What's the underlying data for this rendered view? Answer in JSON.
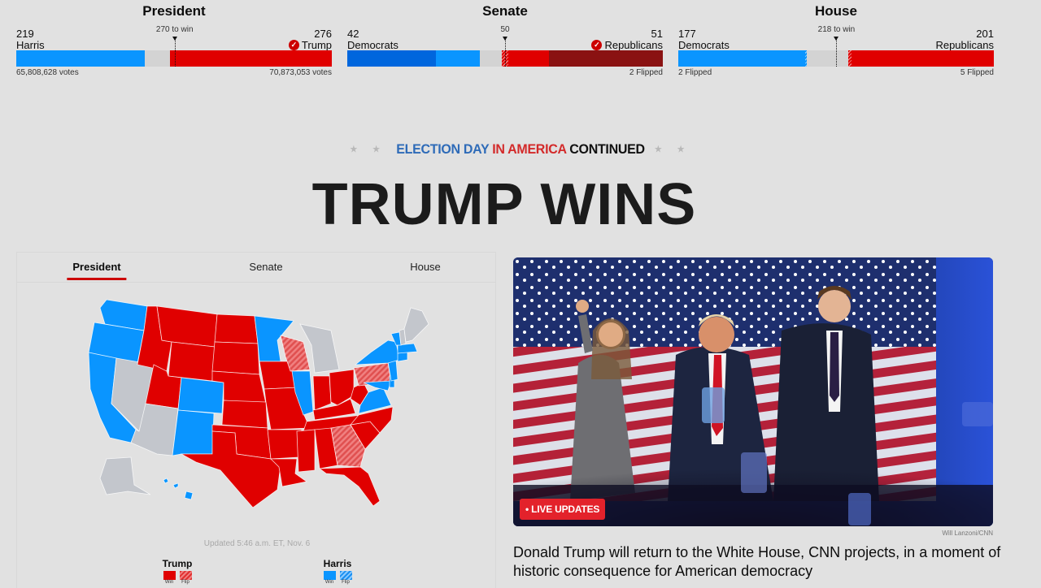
{
  "colors": {
    "dem_safe": "#0a95ff",
    "dem_hold": "#0066dd",
    "rep_win": "#e00000",
    "rep_hold": "#8a1212",
    "undecided": "#d3d3d3",
    "map_gray": "#c3c6cc",
    "accent_red": "#cc0000"
  },
  "races": [
    {
      "title": "President",
      "left": {
        "count": "219",
        "name": "Harris",
        "foot": "65,808,628 votes"
      },
      "right": {
        "count": "276",
        "name": "Trump",
        "foot": "70,873,053 votes",
        "winner": true
      },
      "threshold_label": "270 to win",
      "total": 538,
      "threshold": 270,
      "segments_left": [
        {
          "value": 219,
          "style": "dem"
        }
      ],
      "segments_right": [
        {
          "value": 276,
          "style": "rep"
        }
      ]
    },
    {
      "title": "Senate",
      "left": {
        "count": "42",
        "name": "Democrats",
        "foot": ""
      },
      "right": {
        "count": "51",
        "name": "Republicans",
        "foot": "2 Flipped",
        "winner": true
      },
      "threshold_label": "50",
      "total": 100,
      "threshold": 50,
      "segments_left": [
        {
          "value": 28,
          "style": "dem_hold"
        },
        {
          "value": 14,
          "style": "dem"
        }
      ],
      "segments_right": [
        {
          "value": 2,
          "style": "rep_flip"
        },
        {
          "value": 13,
          "style": "rep"
        },
        {
          "value": 36,
          "style": "rep_hold"
        }
      ]
    },
    {
      "title": "House",
      "left": {
        "count": "177",
        "name": "Democrats",
        "foot": "2 Flipped"
      },
      "right": {
        "count": "201",
        "name": "Republicans",
        "foot": "5 Flipped",
        "winner": false
      },
      "threshold_label": "218 to win",
      "total": 435,
      "threshold": 218,
      "segments_left": [
        {
          "value": 175,
          "style": "dem"
        },
        {
          "value": 2,
          "style": "dem_flip"
        }
      ],
      "segments_right": [
        {
          "value": 5,
          "style": "rep_flip"
        },
        {
          "value": 196,
          "style": "rep"
        }
      ]
    }
  ],
  "kicker": {
    "part1": "ELECTION DAY",
    "part2": "IN AMERICA",
    "part3": "CONTINUED",
    "stars": "★ ★"
  },
  "headline": "TRUMP WINS",
  "map_panel": {
    "tabs": [
      {
        "label": "President",
        "active": true
      },
      {
        "label": "Senate",
        "active": false
      },
      {
        "label": "House",
        "active": false
      }
    ],
    "updated": "Updated 5:46 a.m. ET, Nov. 6",
    "legend": [
      {
        "name": "Trump",
        "win": "Win",
        "flip": "Flip"
      },
      {
        "name": "Harris",
        "win": "Win",
        "flip": "Flip"
      }
    ],
    "states": {
      "rep": [
        "MT",
        "ID",
        "WY",
        "UT",
        "ND",
        "SD",
        "NE",
        "KS",
        "OK",
        "TX",
        "MO",
        "IA",
        "AR",
        "LA",
        "MS",
        "AL",
        "TN",
        "KY",
        "IN",
        "OH",
        "WV",
        "NC",
        "SC",
        "FL",
        "AK_no"
      ],
      "rep_flip": [
        "WI",
        "PA",
        "GA"
      ],
      "dem": [
        "WA",
        "OR",
        "CA",
        "CO",
        "NM",
        "MN",
        "IL",
        "VA",
        "NY",
        "NJ",
        "MA",
        "CT",
        "VT",
        "MD",
        "DE",
        "HI"
      ],
      "undecided": [
        "NV",
        "AZ",
        "MI",
        "ME",
        "AK"
      ]
    }
  },
  "story": {
    "badge": "• LIVE UPDATES",
    "credit": "Will Lanzoni/CNN",
    "headline": "Donald Trump will return to the White House, CNN projects, in a moment of historic consequence for American democracy"
  }
}
